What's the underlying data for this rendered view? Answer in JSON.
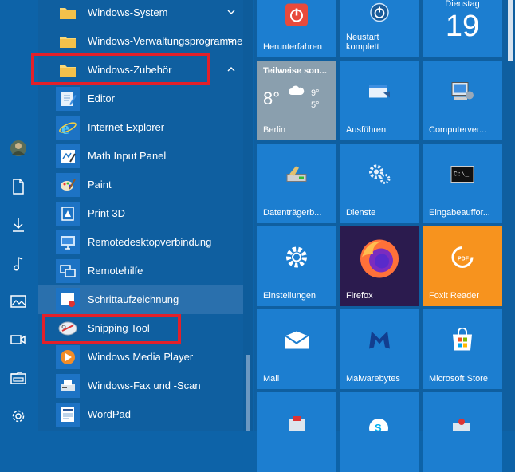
{
  "applist": {
    "folders": [
      {
        "label": "Windows-System"
      },
      {
        "label": "Windows-Verwaltungsprogramme"
      },
      {
        "label": "Windows-Zubehör"
      }
    ],
    "apps": [
      {
        "label": "Editor"
      },
      {
        "label": "Internet Explorer"
      },
      {
        "label": "Math Input Panel"
      },
      {
        "label": "Paint"
      },
      {
        "label": "Print 3D"
      },
      {
        "label": "Remotedesktopverbindung"
      },
      {
        "label": "Remotehilfe"
      },
      {
        "label": "Schrittaufzeichnung"
      },
      {
        "label": "Snipping Tool"
      },
      {
        "label": "Windows Media Player"
      },
      {
        "label": "Windows-Fax und -Scan"
      },
      {
        "label": "WordPad"
      }
    ]
  },
  "tiles": {
    "row1": [
      {
        "label": "Herunterfahren"
      },
      {
        "label": "Neustart\nkomplett"
      },
      {
        "label": "Dienstag",
        "day": "19"
      }
    ],
    "weather": {
      "condition": "Teilweise son...",
      "temp": "8°",
      "high": "9°",
      "low": "5°",
      "city": "Berlin"
    },
    "row2": [
      {
        "label": "Ausführen"
      },
      {
        "label": "Computerver..."
      }
    ],
    "row3": [
      {
        "label": "Datenträgerb..."
      },
      {
        "label": "Dienste"
      },
      {
        "label": "Eingabeauffor..."
      }
    ],
    "row4": [
      {
        "label": "Einstellungen"
      },
      {
        "label": "Firefox"
      },
      {
        "label": "Foxit Reader"
      }
    ],
    "row5": [
      {
        "label": "Mail"
      },
      {
        "label": "Malwarebytes"
      },
      {
        "label": "Microsoft Store"
      }
    ]
  },
  "colors": {
    "accent": "#1c7ed0",
    "highlight_box": "#e2202a",
    "foxit": "#f7931e",
    "firefox_bg": "#2b1b4e"
  }
}
